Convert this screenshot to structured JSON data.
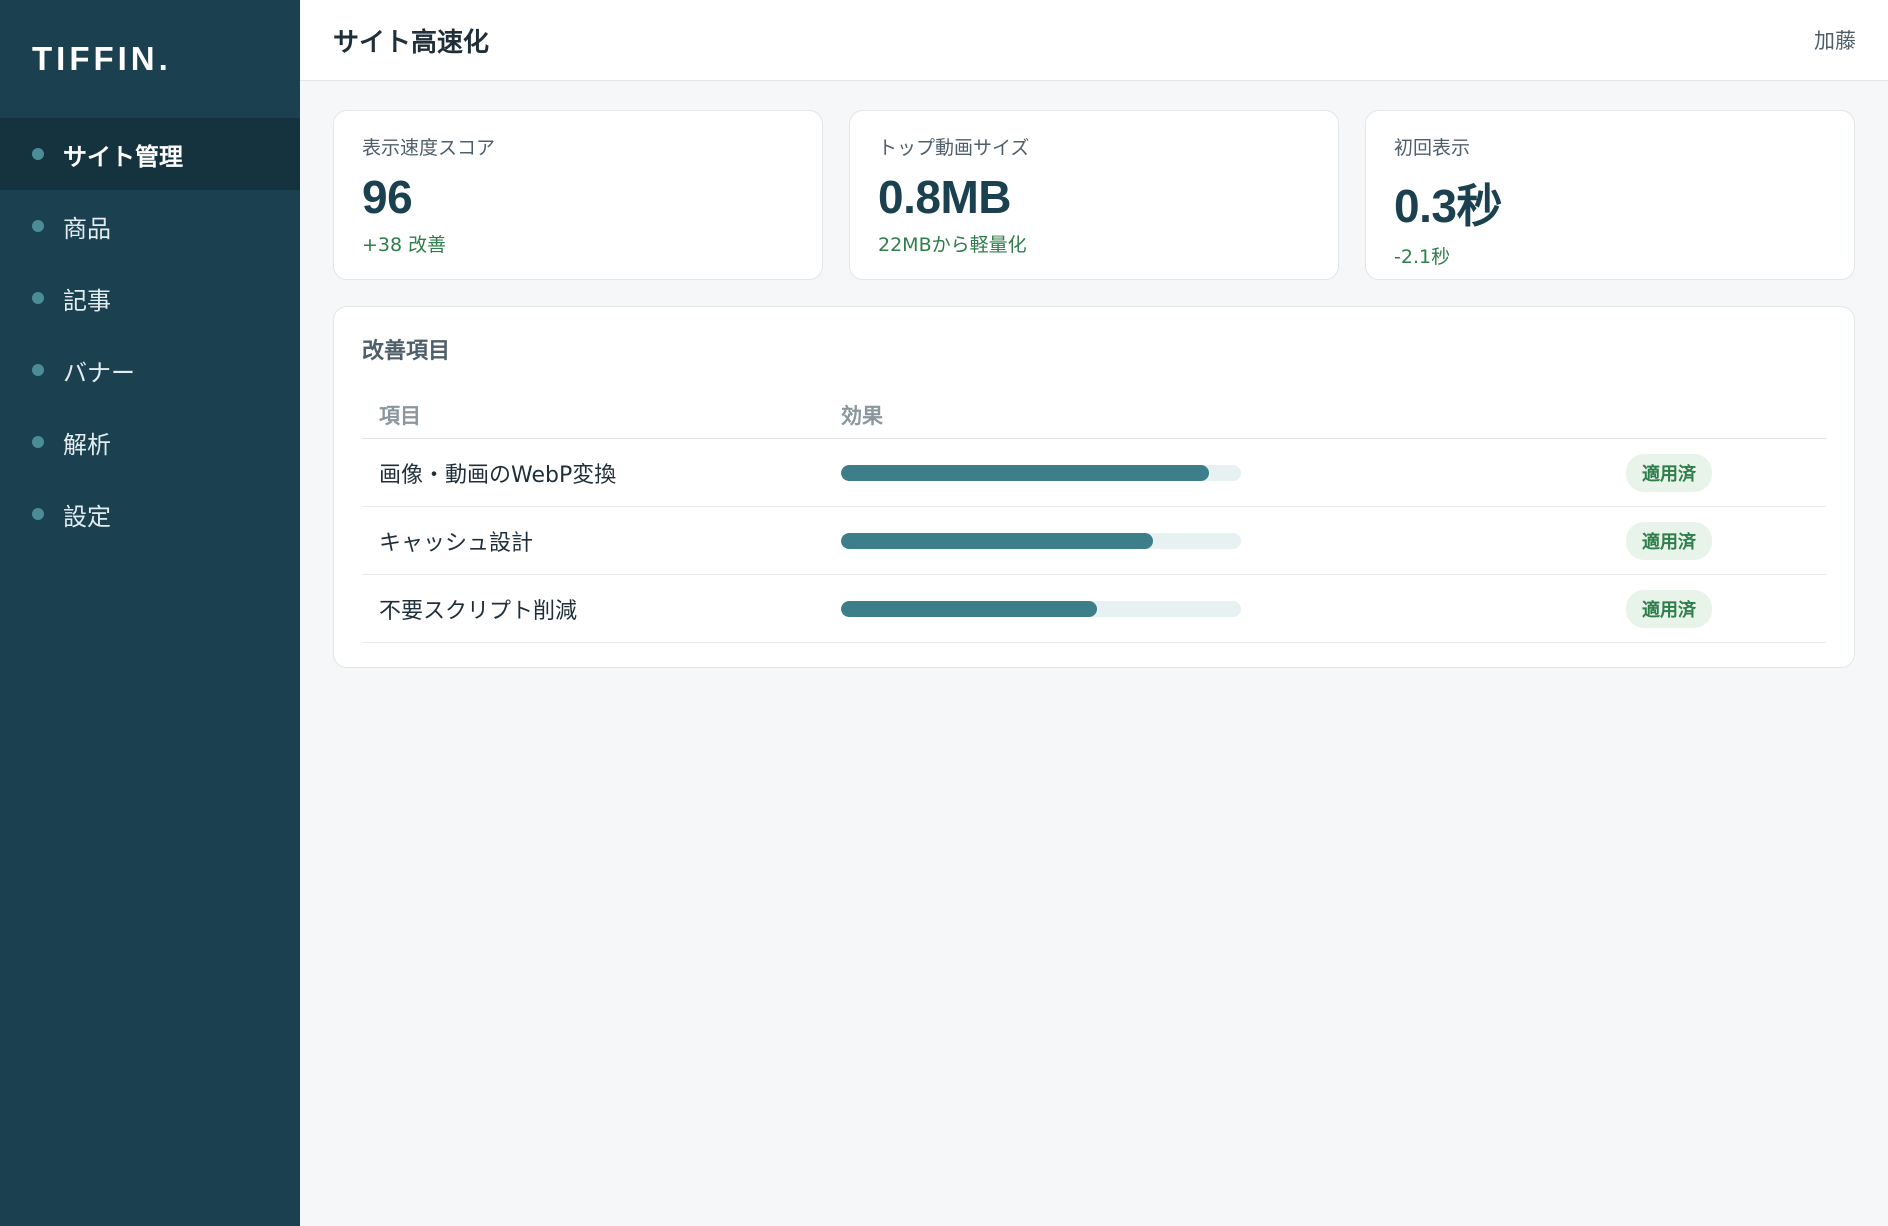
{
  "sidebar": {
    "logo": "TIFFIN.",
    "items": [
      {
        "label": "サイト管理",
        "active": true
      },
      {
        "label": "商品",
        "active": false
      },
      {
        "label": "記事",
        "active": false
      },
      {
        "label": "バナー",
        "active": false
      },
      {
        "label": "解析",
        "active": false
      },
      {
        "label": "設定",
        "active": false
      }
    ]
  },
  "header": {
    "title": "サイト高速化",
    "user": "加藤"
  },
  "kpis": [
    {
      "label": "表示速度スコア",
      "value": "96",
      "delta": "+38 改善"
    },
    {
      "label": "トップ動画サイズ",
      "value": "0.8MB",
      "delta": "22MBから軽量化"
    },
    {
      "label": "初回表示",
      "value": "0.3秒",
      "delta": "-2.1秒"
    }
  ],
  "improvements": {
    "title": "改善項目",
    "columns": [
      "項目",
      "効果"
    ],
    "rows": [
      {
        "name": "画像・動画のWebP変換",
        "effect": 92,
        "status": "適用済"
      },
      {
        "name": "キャッシュ設計",
        "effect": 78,
        "status": "適用済"
      },
      {
        "name": "不要スクリプト削減",
        "effect": 64,
        "status": "適用済"
      }
    ]
  },
  "colors": {
    "sidebar_bg": "#1b4150",
    "sidebar_active_bg": "#15323f",
    "accent": "#3d7e8b",
    "success": "#2e7d4a"
  }
}
